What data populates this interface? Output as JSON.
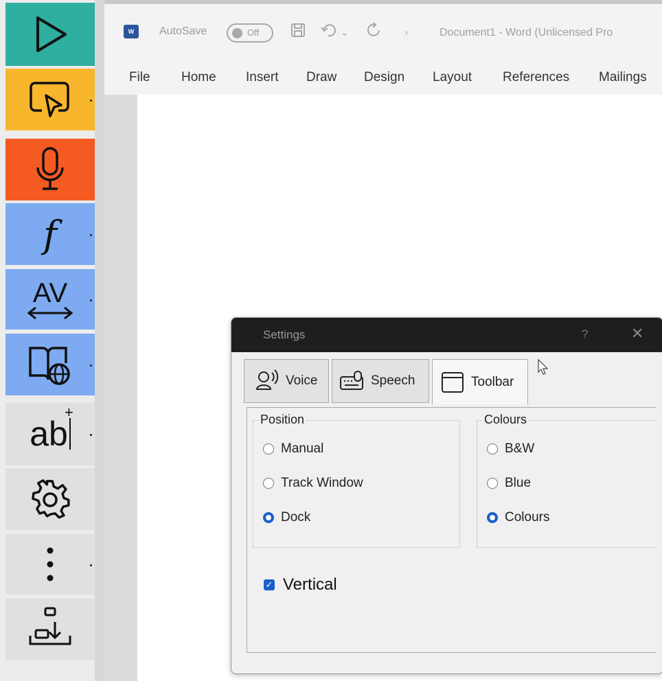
{
  "toolbar": {
    "buttons": [
      {
        "name": "play",
        "color": "#2eaf9f"
      },
      {
        "name": "screen-pointer",
        "color": "#f8b62c"
      },
      {
        "name": "microphone",
        "color": "#f55a22"
      },
      {
        "name": "font-style",
        "color": "#7daaf0"
      },
      {
        "name": "character-spacing",
        "color": "#7daaf0"
      },
      {
        "name": "translate-dictionary",
        "color": "#7daaf0"
      },
      {
        "name": "text-insert",
        "color": "#e0e0e0"
      },
      {
        "name": "settings",
        "color": "#e0e0e0"
      },
      {
        "name": "more",
        "color": "#e0e0e0"
      },
      {
        "name": "download-tray",
        "color": "#e0e0e0"
      }
    ],
    "font_glyph": "f",
    "spacing_glyph": "AV",
    "text_glyph": "ab",
    "text_plus": "+"
  },
  "word": {
    "logo": "W",
    "autosave_label": "AutoSave",
    "autosave_state": "Off",
    "doc_title": "Document1  -  Word (Unlicensed Pro",
    "tabs": [
      "File",
      "Home",
      "Insert",
      "Draw",
      "Design",
      "Layout",
      "References",
      "Mailings"
    ]
  },
  "dialog": {
    "title": "Settings",
    "help": "?",
    "close": "✕",
    "tabs": [
      "Voice",
      "Speech",
      "Toolbar"
    ],
    "active_tab": "Toolbar",
    "position": {
      "label": "Position",
      "options": [
        "Manual",
        "Track Window",
        "Dock"
      ],
      "selected": "Dock"
    },
    "colours": {
      "label": "Colours",
      "options": [
        "B&W",
        "Blue",
        "Colours"
      ],
      "selected": "Colours"
    },
    "vertical": {
      "label": "Vertical",
      "checked": true
    }
  }
}
